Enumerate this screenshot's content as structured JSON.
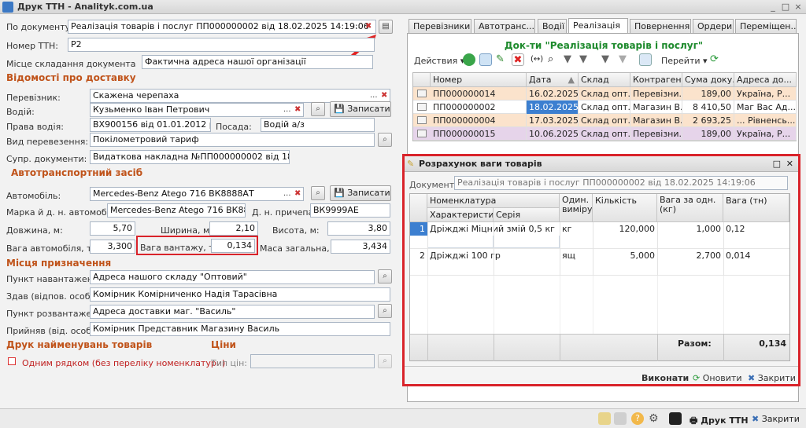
{
  "window": {
    "title": "Друк ТТН - Analityk.com.ua",
    "controls": [
      "_",
      "□",
      "×"
    ]
  },
  "form": {
    "po_dokumentu_label": "По документу:",
    "po_dokumentu_value": "Реалізація товарів і послуг ПП000000002 від 18.02.2025 14:19:06",
    "nomer_label": "Номер ТТН:",
    "nomer_value": "Р2",
    "misce_label": "Місце складання документа",
    "misce_value": "Фактична адреса нашої організації",
    "delivery_section": "Відомості про доставку",
    "perevoznyk_label": "Перевізник:",
    "perevoznyk_value": "Скажена черепаха",
    "vodiy_label": "Водій:",
    "vodiy_value": "Кузьменко Іван Петрович",
    "zapysaty": "Записати",
    "prava_label": "Права водія:",
    "prava_value": "ВХ900156 від 01.01.2012 року",
    "posada_label": "Посада:",
    "posada_value": "Водій а/з",
    "vyd_label": "Вид перевезення:",
    "vyd_value": "Покілометровий тариф",
    "supr_label": "Супр. документи:",
    "supr_value": "Видаткова накладна №ПП000000002 від 18.02.25р.",
    "vehicle_section": "Автотранспортний засіб",
    "avto_label": "Автомобіль:",
    "avto_value": "Mercedes-Benz Atego 716 ВК8888АТ",
    "marka_label": "Марка й д. н. автомобіля:",
    "marka_value": "Mercedes-Benz Atego 716 ВК8888АТ",
    "prychep_label": "Д. н. причепа:",
    "prychep_value": "ВК9999АЕ",
    "dovzhyna_label": "Довжина, м:",
    "dovzhyna_value": "5,70",
    "shyryna_label": "Ширина, м:",
    "shyryna_value": "2,10",
    "vysota_label": "Висота, м:",
    "vysota_value": "3,80",
    "vaga_avto_label": "Вага автомобіля, т",
    "vaga_avto_value": "3,300",
    "vaga_vant_label": "Вага вантажу, т",
    "vaga_vant_value": "0,134",
    "masa_label": "Маса загальна, т:",
    "masa_value": "3,434",
    "dest_section": "Місця призначення",
    "punkt_nav_label": "Пункт навантажен...",
    "punkt_nav_value": "Адреса нашого складу \"Оптовий\"",
    "zdav_label": "Здав (відпов. особ...",
    "zdav_value": "Комірник Комірниченко Надія Тарасівна",
    "punkt_roz_label": "Пункт розвантаже...",
    "punkt_roz_value": "Адреса доставки маг. \"Василь\"",
    "pryynyav_label": "Прийняв (від. особ...",
    "pryynyav_value": "Комірник Представник Магазину Василь",
    "print_section": "Друк найменувань товарів",
    "ciny_section": "Ціни",
    "odnym_label": "Одним рядком (без переліку номенклатури)",
    "typ_label": "Тип цін:"
  },
  "tabs": [
    "Перевізники",
    "Автотранс...",
    "Водії",
    "Реалізація",
    "Повернення",
    "Ордери",
    "Переміщен..."
  ],
  "right_panel": {
    "title": "Док-ти \"Реалізація товарів і послуг\"",
    "actions_label": "Действия",
    "goto_label": "Перейти",
    "headers": [
      "Номер",
      "Дата",
      "Склад",
      "Контрагент",
      "Сума доку...",
      "Адреса до..."
    ],
    "rows": [
      {
        "num": "ПП000000014",
        "date": "16.02.2025 ...",
        "sklad": "Склад опт...",
        "kontr": "Перевізни...",
        "suma": "189,00",
        "adr": "Україна, Р..."
      },
      {
        "num": "ПП000000002",
        "date": "18.02.2025 ...",
        "sklad": "Склад опт...",
        "kontr": "Магазин В...",
        "suma": "8 410,50",
        "adr": "Маг Вас Ад..."
      },
      {
        "num": "ПП000000004",
        "date": "17.03.2025 ...",
        "sklad": "Склад опт...",
        "kontr": "Магазин В...",
        "suma": "2 693,25",
        "adr": "... Рівненсь..."
      },
      {
        "num": "ПП000000015",
        "date": "10.06.2025 ...",
        "sklad": "Склад опт...",
        "kontr": "Перевізни...",
        "suma": "189,00",
        "adr": "Україна, Р..."
      }
    ]
  },
  "dialog": {
    "title": "Розрахунок ваги товарів",
    "doc_label": "Документ:",
    "doc_value": "Реалізація товарів і послуг ПП000000002 від 18.02.2025 14:19:06",
    "h_nom": "Номенклатура",
    "h_char": "Характеристи...",
    "h_seria": "Серія",
    "h_od": "Один. виміру",
    "h_kilk": "Кількість",
    "h_vaga_od": "Вага за одн. (кг)",
    "h_vaga": "Вага (тн)",
    "rows": [
      {
        "n": "1",
        "name": "Дріжджі Міцний змій 0,5 кг",
        "od": "кг",
        "kilk": "120,000",
        "vaga_od": "1,000",
        "vaga": "0,12"
      },
      {
        "n": "2",
        "name": "Дріжджі 100 гр",
        "od": "ящ",
        "kilk": "5,000",
        "vaga_od": "2,700",
        "vaga": "0,014"
      }
    ],
    "razom_label": "Разом:",
    "razom_value": "0,134",
    "vykonaty": "Виконати",
    "onovyty": "Оновити",
    "zakryty": "Закрити"
  },
  "bottom": {
    "druk": "Друк ТТН",
    "zakryty": "Закрити"
  }
}
